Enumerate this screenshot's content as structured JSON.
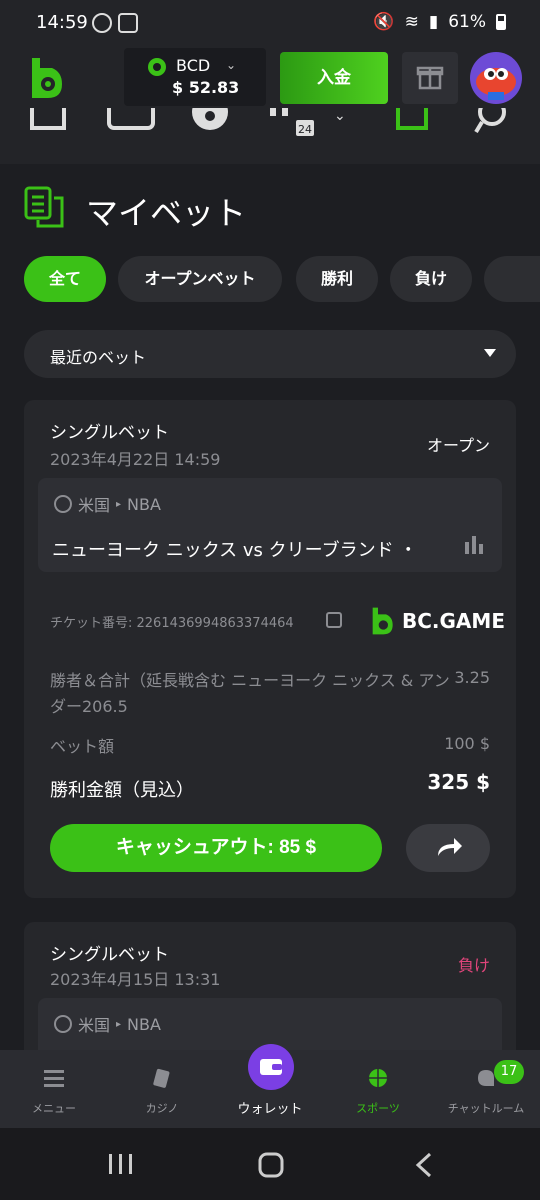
{
  "status_bar": {
    "time": "14:59",
    "battery": "61%"
  },
  "header": {
    "currency": "BCD",
    "balance": "$ 52.83",
    "deposit_label": "入金"
  },
  "page": {
    "title": "マイベット"
  },
  "filters": {
    "chips": [
      "全て",
      "オープンベット",
      "勝利",
      "負け"
    ],
    "active": "全て"
  },
  "select": {
    "label": "最近のベット"
  },
  "bets": [
    {
      "type": "シングルベット",
      "date": "2023年4月22日 14:59",
      "status": "オープン",
      "country": "米国",
      "league": "NBA",
      "match": "ニューヨーク ニックス vs クリーブランド ・",
      "ticket": "チケット番号: 2261436994863374464",
      "brand": "BC.GAME",
      "market": "勝者＆合計（延長戦含む ニューヨーク ニックス & アンダー206.5",
      "odds": "3.25",
      "stake_label": "ベット額",
      "stake": "100 $",
      "win_label": "勝利金額（見込）",
      "win": "325 $",
      "cashout": "キャッシュアウト: 85 $"
    },
    {
      "type": "シングルベット",
      "date": "2023年4月15日 13:31",
      "status": "負け",
      "country": "米国",
      "league": "NBA"
    }
  ],
  "bottom_nav": [
    "メニュー",
    "カジノ",
    "ウォレット",
    "スポーツ",
    "チャットルーム"
  ],
  "chat_badge": "17",
  "colors": {
    "accent": "#3bc117",
    "loss": "#e0457b",
    "wallet": "#7b3fe4"
  }
}
